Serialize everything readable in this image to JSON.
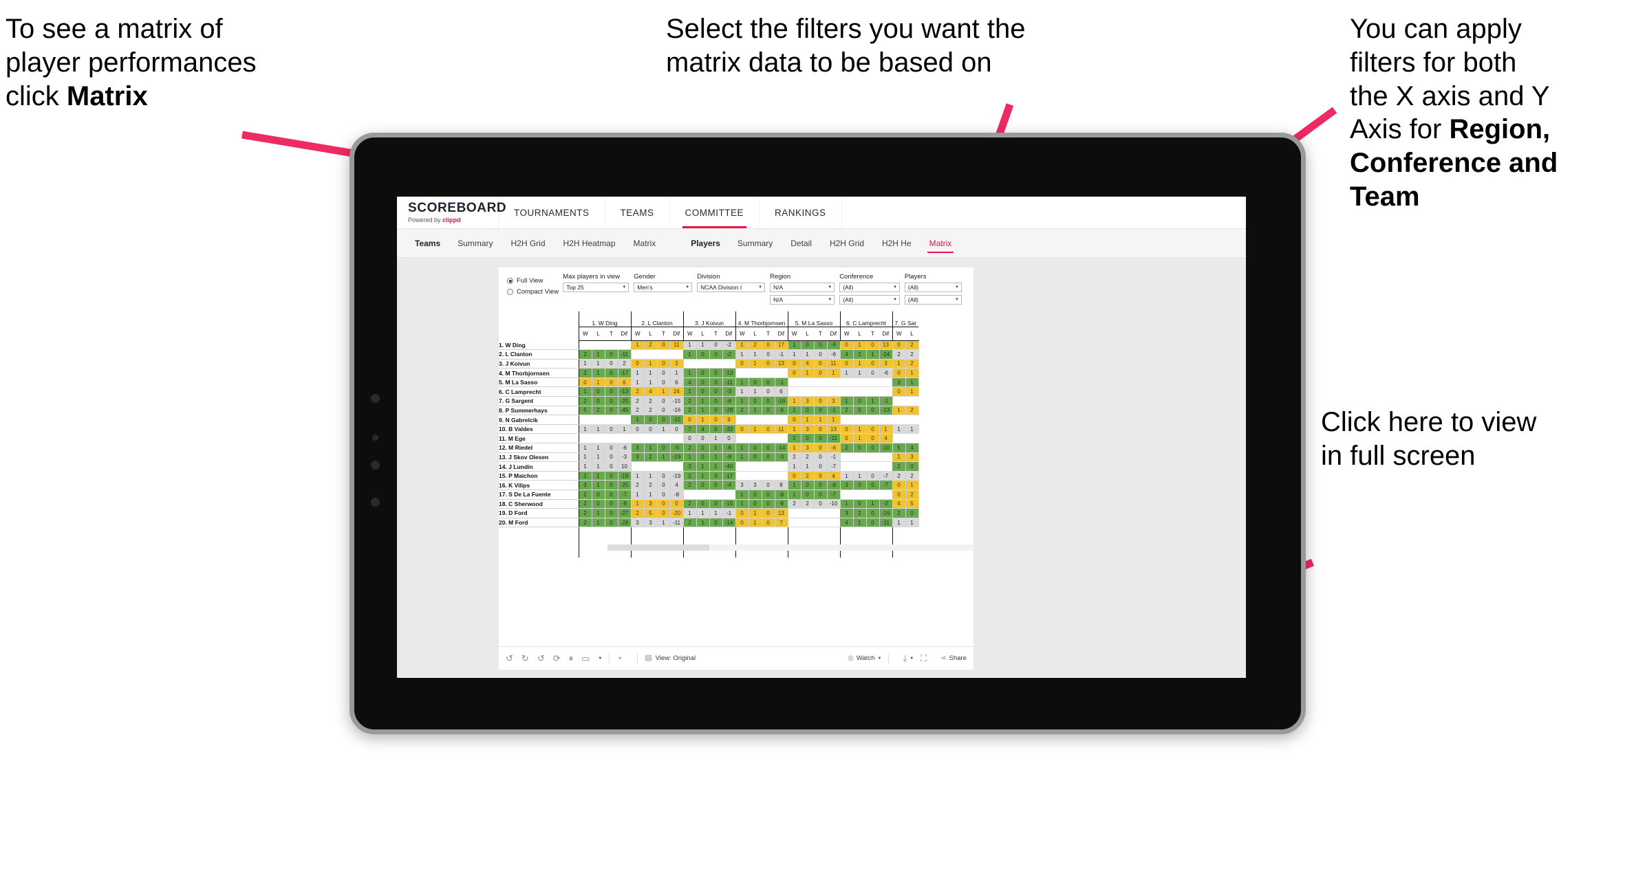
{
  "annotations": {
    "left": {
      "pre": "To see a matrix of\nplayer performances\nclick ",
      "bold": "Matrix"
    },
    "middle": {
      "text": "Select the filters you want the\nmatrix data to be based on"
    },
    "right": {
      "pre": "You  can apply\nfilters for both\nthe X axis and Y\nAxis for ",
      "bold": "Region,\nConference and\nTeam"
    },
    "fullscreen": {
      "text": "Click here to view\nin full screen"
    },
    "accent_color": "#ee2a64"
  },
  "app": {
    "brand": {
      "name": "SCOREBOARD",
      "powered_prefix": "Powered by ",
      "powered_brand": "clippd"
    },
    "topnav": [
      {
        "label": "TOURNAMENTS",
        "active": false
      },
      {
        "label": "TEAMS",
        "active": false
      },
      {
        "label": "COMMITTEE",
        "active": true
      },
      {
        "label": "RANKINGS",
        "active": false
      }
    ],
    "subnav": {
      "teams_label": "Teams",
      "teams_items": [
        "Summary",
        "H2H Grid",
        "H2H Heatmap",
        "Matrix"
      ],
      "players_label": "Players",
      "players_items": [
        "Summary",
        "Detail",
        "H2H Grid",
        "H2H He"
      ],
      "players_active": "Matrix"
    },
    "view_options": [
      {
        "label": "Full View",
        "selected": true
      },
      {
        "label": "Compact View",
        "selected": false
      }
    ],
    "filters": [
      {
        "label": "Max players in view",
        "rows": [
          "Top 25"
        ]
      },
      {
        "label": "Gender",
        "rows": [
          "Men's"
        ]
      },
      {
        "label": "Division",
        "rows": [
          "NCAA Division I"
        ]
      },
      {
        "label": "Region",
        "rows": [
          "N/A",
          "N/A"
        ]
      },
      {
        "label": "Conference",
        "rows": [
          "(All)",
          "(All)"
        ]
      },
      {
        "label": "Players",
        "rows": [
          "(All)",
          "(All)"
        ]
      }
    ],
    "toolbar": {
      "view_label": "View: Original",
      "watch_label": "Watch",
      "share_label": "Share",
      "icons": [
        "undo-icon",
        "redo-icon",
        "revert-icon",
        "pause-icon",
        "refresh-data-icon",
        "device-layout-icon"
      ]
    }
  },
  "chart_data": {
    "type": "table",
    "title": "Player head-to-head matrix",
    "sub_columns": [
      "W",
      "L",
      "T",
      "Dif"
    ],
    "columns": [
      "1. W Ding",
      "2. L Clanton",
      "3. J Koivun",
      "4. M Thorbjornsen",
      "5. M La Sasso",
      "6. C Lamprecht",
      "7. G Sar"
    ],
    "rows": [
      "1. W Ding",
      "2. L Clanton",
      "3. J Koivun",
      "4. M Thorbjornsen",
      "5. M La Sasso",
      "6. C Lamprecht",
      "7. G Sargent",
      "8. P Summerhays",
      "9. N Gabrelcik",
      "10. B Valdes",
      "11. M Ege",
      "12. M Riedel",
      "13. J Skov Olesen",
      "14. J Lundin",
      "15. P Maichon",
      "16. K Vilips",
      "17. S De La Fuente",
      "18. C Sherwood",
      "19. D Ford",
      "20. M Ford"
    ],
    "color_legend": {
      "green": "#6aa84f",
      "yellow": "#f1c232",
      "grey": "#d9d9d9",
      "empty": "#ffffff"
    },
    "cells": [
      [
        [
          null,
          null,
          null,
          null,
          "e"
        ],
        [
          1,
          2,
          0,
          11,
          "y"
        ],
        [
          1,
          1,
          0,
          -2,
          "n"
        ],
        [
          1,
          2,
          0,
          17,
          "y"
        ],
        [
          1,
          0,
          0,
          -6,
          "g"
        ],
        [
          0,
          1,
          0,
          13,
          "y"
        ],
        [
          0,
          2,
          "",
          "",
          "y"
        ]
      ],
      [
        [
          2,
          1,
          0,
          -11,
          "g"
        ],
        [
          null,
          null,
          null,
          null,
          "e"
        ],
        [
          1,
          0,
          0,
          -2,
          "g"
        ],
        [
          1,
          1,
          0,
          -1,
          "n"
        ],
        [
          1,
          1,
          0,
          -6,
          "n"
        ],
        [
          4,
          2,
          1,
          -24,
          "g"
        ],
        [
          2,
          2,
          "",
          "",
          "n"
        ]
      ],
      [
        [
          1,
          1,
          0,
          2,
          "n"
        ],
        [
          0,
          1,
          0,
          2,
          "y"
        ],
        [
          null,
          null,
          null,
          null,
          "e"
        ],
        [
          0,
          1,
          0,
          13,
          "y"
        ],
        [
          0,
          4,
          0,
          11,
          "y"
        ],
        [
          0,
          1,
          0,
          3,
          "y"
        ],
        [
          1,
          2,
          "",
          "",
          "y"
        ]
      ],
      [
        [
          2,
          1,
          0,
          -17,
          "g"
        ],
        [
          1,
          1,
          0,
          1,
          "n"
        ],
        [
          1,
          0,
          0,
          -13,
          "g"
        ],
        [
          null,
          null,
          null,
          null,
          "e"
        ],
        [
          0,
          1,
          0,
          1,
          "y"
        ],
        [
          1,
          1,
          0,
          -6,
          "n"
        ],
        [
          0,
          1,
          "",
          "",
          "y"
        ]
      ],
      [
        [
          0,
          1,
          0,
          6,
          "y"
        ],
        [
          1,
          1,
          0,
          6,
          "n"
        ],
        [
          4,
          0,
          0,
          -11,
          "g"
        ],
        [
          1,
          0,
          0,
          -1,
          "g"
        ],
        [
          null,
          null,
          null,
          null,
          "e"
        ],
        [
          null,
          null,
          null,
          null,
          "e"
        ],
        [
          3,
          1,
          "",
          "",
          "g"
        ]
      ],
      [
        [
          1,
          0,
          0,
          -13,
          "g"
        ],
        [
          2,
          4,
          1,
          24,
          "y"
        ],
        [
          1,
          0,
          0,
          -3,
          "g"
        ],
        [
          1,
          1,
          0,
          6,
          "n"
        ],
        [
          null,
          null,
          null,
          null,
          "e"
        ],
        [
          null,
          null,
          null,
          null,
          "e"
        ],
        [
          0,
          1,
          "",
          "",
          "y"
        ]
      ],
      [
        [
          2,
          0,
          0,
          -25,
          "g"
        ],
        [
          2,
          2,
          0,
          -15,
          "n"
        ],
        [
          2,
          1,
          0,
          -6,
          "g"
        ],
        [
          1,
          0,
          0,
          -16,
          "g"
        ],
        [
          1,
          3,
          0,
          3,
          "y"
        ],
        [
          1,
          0,
          1,
          -1,
          "g"
        ],
        [
          null,
          null,
          "",
          "",
          "e"
        ]
      ],
      [
        [
          5,
          2,
          0,
          -45,
          "g"
        ],
        [
          2,
          2,
          0,
          -16,
          "n"
        ],
        [
          2,
          1,
          0,
          -28,
          "g"
        ],
        [
          2,
          1,
          0,
          -6,
          "g"
        ],
        [
          1,
          0,
          0,
          -1,
          "g"
        ],
        [
          2,
          0,
          0,
          -13,
          "g"
        ],
        [
          1,
          2,
          "",
          "",
          "y"
        ]
      ],
      [
        [
          null,
          null,
          null,
          null,
          "e"
        ],
        [
          1,
          0,
          0,
          -15,
          "g"
        ],
        [
          0,
          1,
          0,
          9,
          "y"
        ],
        [
          null,
          null,
          null,
          null,
          "e"
        ],
        [
          0,
          1,
          1,
          1,
          "y"
        ],
        [
          null,
          null,
          null,
          null,
          "e"
        ],
        [
          null,
          null,
          "",
          "",
          "e"
        ]
      ],
      [
        [
          1,
          1,
          0,
          1,
          "n"
        ],
        [
          0,
          0,
          1,
          0,
          "n"
        ],
        [
          7,
          4,
          0,
          -32,
          "g"
        ],
        [
          0,
          1,
          0,
          11,
          "y"
        ],
        [
          1,
          3,
          0,
          13,
          "y"
        ],
        [
          0,
          1,
          0,
          1,
          "y"
        ],
        [
          1,
          1,
          "",
          "",
          "n"
        ]
      ],
      [
        [
          null,
          null,
          null,
          null,
          "e"
        ],
        [
          null,
          null,
          null,
          null,
          "e"
        ],
        [
          0,
          0,
          1,
          0,
          "n"
        ],
        [
          null,
          null,
          null,
          null,
          "e"
        ],
        [
          2,
          0,
          0,
          -11,
          "g"
        ],
        [
          0,
          1,
          0,
          4,
          "y"
        ],
        [
          null,
          null,
          "",
          "",
          "e"
        ]
      ],
      [
        [
          1,
          1,
          0,
          -6,
          "n"
        ],
        [
          3,
          1,
          0,
          -5,
          "g"
        ],
        [
          2,
          0,
          1,
          -6,
          "g"
        ],
        [
          1,
          0,
          0,
          -14,
          "g"
        ],
        [
          1,
          3,
          0,
          -6,
          "y"
        ],
        [
          2,
          0,
          0,
          -10,
          "g"
        ],
        [
          5,
          4,
          "",
          "",
          "g"
        ]
      ],
      [
        [
          1,
          1,
          0,
          -3,
          "n"
        ],
        [
          3,
          2,
          1,
          -19,
          "g"
        ],
        [
          1,
          0,
          1,
          -9,
          "g"
        ],
        [
          1,
          0,
          0,
          -3,
          "g"
        ],
        [
          2,
          2,
          0,
          -1,
          "n"
        ],
        [
          null,
          null,
          null,
          null,
          "e"
        ],
        [
          1,
          3,
          "",
          "",
          "y"
        ]
      ],
      [
        [
          1,
          1,
          0,
          10,
          "n"
        ],
        [
          null,
          null,
          null,
          null,
          "e"
        ],
        [
          3,
          1,
          1,
          -40,
          "g"
        ],
        [
          null,
          null,
          null,
          null,
          "e"
        ],
        [
          1,
          1,
          0,
          -7,
          "n"
        ],
        [
          null,
          null,
          null,
          null,
          "e"
        ],
        [
          2,
          0,
          "",
          "",
          "g"
        ]
      ],
      [
        [
          2,
          1,
          0,
          -19,
          "g"
        ],
        [
          1,
          1,
          0,
          -19,
          "n"
        ],
        [
          2,
          1,
          0,
          -17,
          "g"
        ],
        [
          null,
          null,
          null,
          null,
          "e"
        ],
        [
          0,
          2,
          0,
          4,
          "y"
        ],
        [
          1,
          1,
          0,
          -7,
          "n"
        ],
        [
          2,
          2,
          "",
          "",
          "n"
        ]
      ],
      [
        [
          3,
          1,
          0,
          -25,
          "g"
        ],
        [
          2,
          2,
          0,
          4,
          "n"
        ],
        [
          2,
          0,
          0,
          -4,
          "g"
        ],
        [
          3,
          3,
          0,
          8,
          "n"
        ],
        [
          1,
          0,
          0,
          -8,
          "g"
        ],
        [
          3,
          0,
          0,
          -7,
          "g"
        ],
        [
          0,
          1,
          "",
          "",
          "y"
        ]
      ],
      [
        [
          2,
          0,
          0,
          -7,
          "g"
        ],
        [
          1,
          1,
          0,
          -8,
          "n"
        ],
        [
          null,
          null,
          null,
          null,
          "e"
        ],
        [
          1,
          0,
          0,
          -8,
          "g"
        ],
        [
          1,
          0,
          0,
          -7,
          "g"
        ],
        [
          null,
          null,
          null,
          null,
          "e"
        ],
        [
          0,
          2,
          "",
          "",
          "y"
        ]
      ],
      [
        [
          2,
          0,
          0,
          -9,
          "g"
        ],
        [
          1,
          3,
          0,
          0,
          "y"
        ],
        [
          2,
          0,
          0,
          -15,
          "g"
        ],
        [
          1,
          0,
          0,
          -8,
          "g"
        ],
        [
          2,
          2,
          0,
          -10,
          "n"
        ],
        [
          1,
          0,
          1,
          -2,
          "g"
        ],
        [
          4,
          5,
          "",
          "",
          "y"
        ]
      ],
      [
        [
          2,
          1,
          0,
          -27,
          "g"
        ],
        [
          2,
          5,
          0,
          -20,
          "y"
        ],
        [
          1,
          1,
          1,
          -1,
          "n"
        ],
        [
          0,
          1,
          0,
          13,
          "y"
        ],
        [
          null,
          null,
          null,
          null,
          "e"
        ],
        [
          3,
          2,
          0,
          -16,
          "g"
        ],
        [
          2,
          0,
          "",
          "",
          "g"
        ]
      ],
      [
        [
          2,
          1,
          0,
          -28,
          "g"
        ],
        [
          3,
          3,
          1,
          -11,
          "n"
        ],
        [
          2,
          1,
          0,
          -14,
          "g"
        ],
        [
          0,
          1,
          0,
          7,
          "y"
        ],
        [
          null,
          null,
          null,
          null,
          "e"
        ],
        [
          4,
          1,
          0,
          -11,
          "g"
        ],
        [
          1,
          1,
          "",
          "",
          "n"
        ]
      ]
    ]
  }
}
